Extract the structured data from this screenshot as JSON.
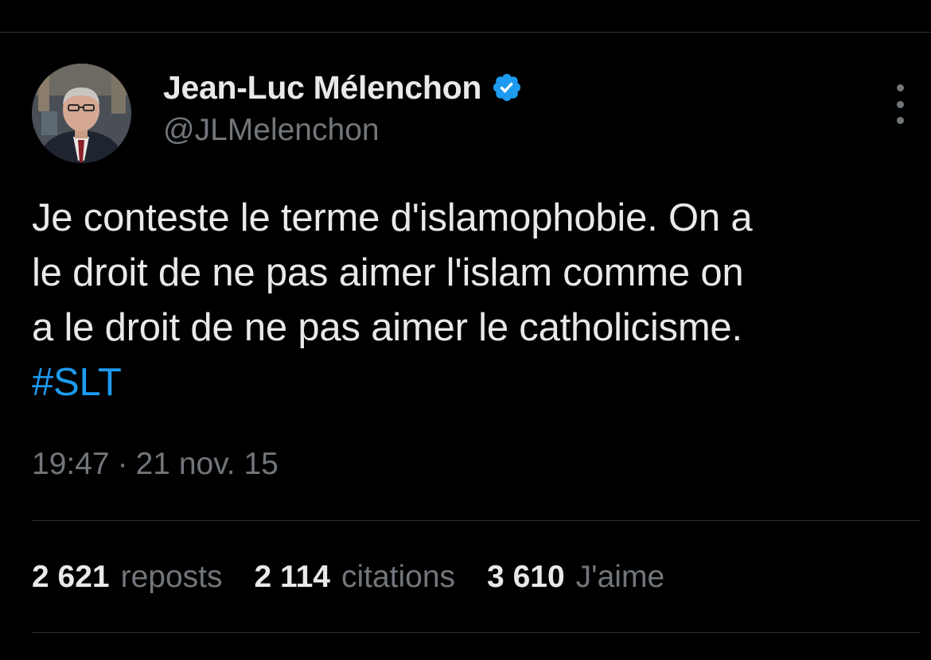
{
  "tweet": {
    "author": {
      "name": "Jean-Luc Mélenchon",
      "handle": "@JLMelenchon",
      "verified": true
    },
    "text_lines": [
      "Je conteste le terme d'islamophobie. On a",
      "le droit de ne pas aimer l'islam comme on",
      "a le droit de ne pas aimer le catholicisme."
    ],
    "hashtag": "#SLT",
    "time": "19:47",
    "separator": "·",
    "date": "21 nov. 15"
  },
  "stats": [
    {
      "count": "2 621",
      "label": "reposts"
    },
    {
      "count": "2 114",
      "label": "citations"
    },
    {
      "count": "3 610",
      "label": "J'aime"
    }
  ],
  "icons": {
    "verified": "verified-badge-icon",
    "more": "more-options-icon"
  },
  "colors": {
    "background": "#000000",
    "text": "#e7e9ea",
    "secondary": "#71767b",
    "accent": "#1d9bf0",
    "divider": "#2f3336"
  }
}
